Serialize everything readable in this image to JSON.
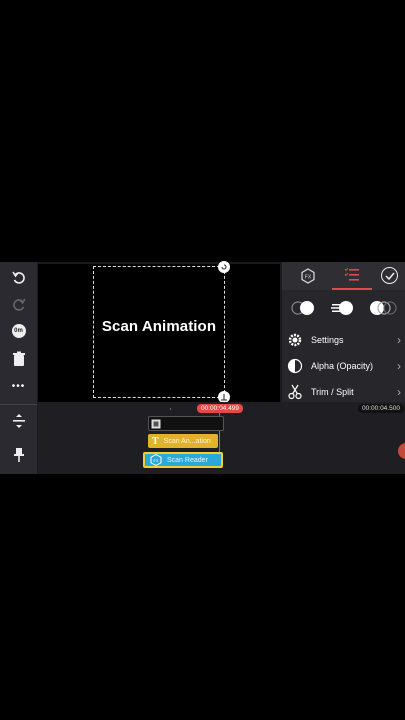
{
  "canvas": {
    "text": "Scan Animation"
  },
  "toolbar_left": {
    "undo_icon": "undo-icon",
    "redo_icon": "redo-icon",
    "speed_label": "0m",
    "delete_icon": "trash-icon",
    "more_label": "•••",
    "adjust_icon": "align-icon",
    "pin_icon": "pin-icon"
  },
  "panel": {
    "tabs": [
      "fx-tab",
      "list-tab",
      "check-tab"
    ],
    "rows": [
      {
        "label": "Settings",
        "icon": "gear-icon"
      },
      {
        "label": "Alpha (Opacity)",
        "icon": "opacity-icon"
      },
      {
        "label": "Trim / Split",
        "icon": "scissors-icon"
      }
    ]
  },
  "timeline": {
    "playhead_time": "00:00:04.499",
    "end_time": "00:00:04.500",
    "clips": {
      "text_clip": "Scan An...ation",
      "fx_clip": "Scan Reader"
    }
  },
  "colors": {
    "accent": "#e04a4a",
    "text_clip": "#e0b32a",
    "fx_clip": "#2aa8d8",
    "selection": "#f0d030"
  }
}
